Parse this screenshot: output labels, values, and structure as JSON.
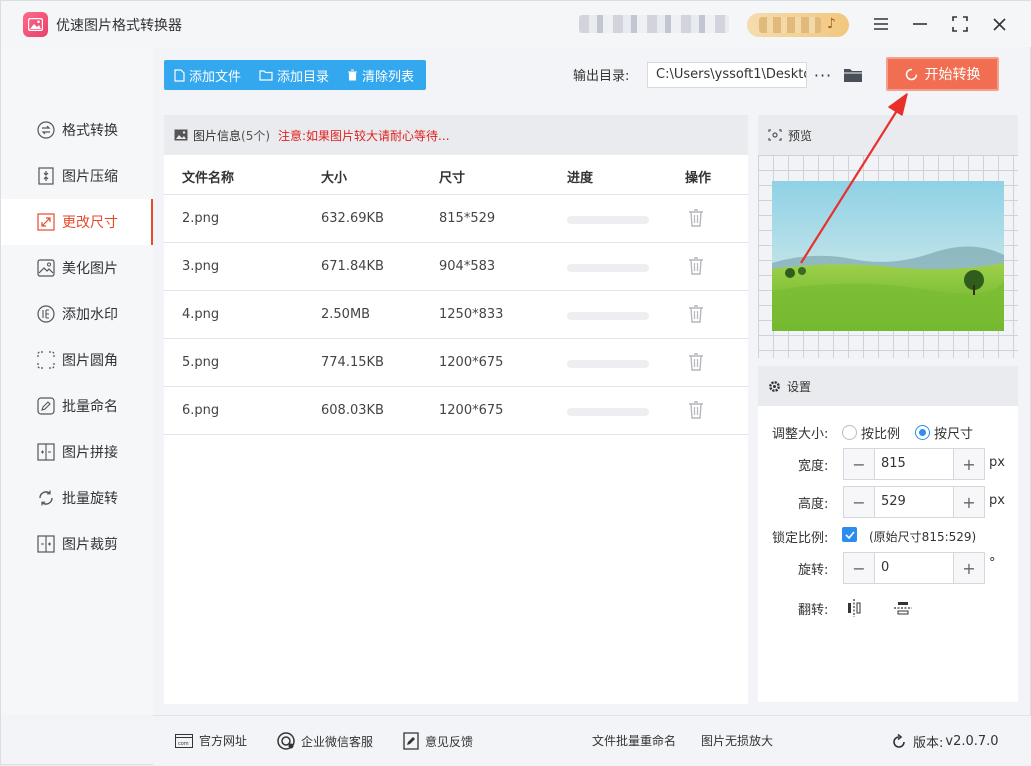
{
  "app": {
    "title": "优速图片格式转换器",
    "window_controls": {
      "menu": "≡",
      "minimize": "—",
      "close": "✕"
    }
  },
  "sidebar": {
    "items": [
      {
        "label": "格式转换",
        "icon": "format-convert-icon",
        "active": false
      },
      {
        "label": "图片压缩",
        "icon": "compress-icon",
        "active": false
      },
      {
        "label": "更改尺寸",
        "icon": "resize-icon",
        "active": true
      },
      {
        "label": "美化图片",
        "icon": "beautify-icon",
        "active": false
      },
      {
        "label": "添加水印",
        "icon": "watermark-icon",
        "active": false
      },
      {
        "label": "图片圆角",
        "icon": "rounded-corner-icon",
        "active": false
      },
      {
        "label": "批量命名",
        "icon": "rename-icon",
        "active": false
      },
      {
        "label": "图片拼接",
        "icon": "stitch-icon",
        "active": false
      },
      {
        "label": "批量旋转",
        "icon": "rotate-icon",
        "active": false
      },
      {
        "label": "图片裁剪",
        "icon": "crop-icon",
        "active": false
      }
    ]
  },
  "toolbar": {
    "add_file": "添加文件",
    "add_folder": "添加目录",
    "clear_list": "清除列表",
    "output_label": "输出目录:",
    "output_path": "C:\\Users\\yssoft1\\Deskto",
    "more": "···",
    "start": "开始转换"
  },
  "file_panel": {
    "title": "图片信息",
    "count": "(5个)",
    "warning": "注意:如果图片较大请耐心等待...",
    "columns": {
      "name": "文件名称",
      "size": "大小",
      "dims": "尺寸",
      "progress": "进度",
      "action": "操作"
    },
    "rows": [
      {
        "name": "2.png",
        "size": "632.69KB",
        "dims": "815*529",
        "progress": 0
      },
      {
        "name": "3.png",
        "size": "671.84KB",
        "dims": "904*583",
        "progress": 0
      },
      {
        "name": "4.png",
        "size": "2.50MB",
        "dims": "1250*833",
        "progress": 0
      },
      {
        "name": "5.png",
        "size": "774.15KB",
        "dims": "1200*675",
        "progress": 0
      },
      {
        "name": "6.png",
        "size": "608.03KB",
        "dims": "1200*675",
        "progress": 0
      }
    ]
  },
  "preview": {
    "title": "预览"
  },
  "settings": {
    "title": "设置",
    "resize_label": "调整大小:",
    "by_ratio": "按比例",
    "by_size": "按尺寸",
    "selected_mode": "by_size",
    "width_label": "宽度:",
    "width_value": "815",
    "height_label": "高度:",
    "height_value": "529",
    "unit": "px",
    "lock_label": "锁定比例:",
    "lock_checked": true,
    "original_size": "(原始尺寸815:529)",
    "rotate_label": "旋转:",
    "rotate_value": "0",
    "degree": "°",
    "flip_label": "翻转:",
    "minus": "−",
    "plus": "+"
  },
  "statusbar": {
    "website": "官方网址",
    "wechat": "企业微信客服",
    "feedback": "意见反馈",
    "batch_rename": "文件批量重命名",
    "lossless": "图片无损放大",
    "version_label": "版本:",
    "version": "v2.0.7.0"
  },
  "colors": {
    "accent": "#e64b2c",
    "start_button": "#f26e52",
    "toolbar_blue": "#34a8ef",
    "warning_red": "#e02020",
    "check_blue": "#2c8df0"
  }
}
